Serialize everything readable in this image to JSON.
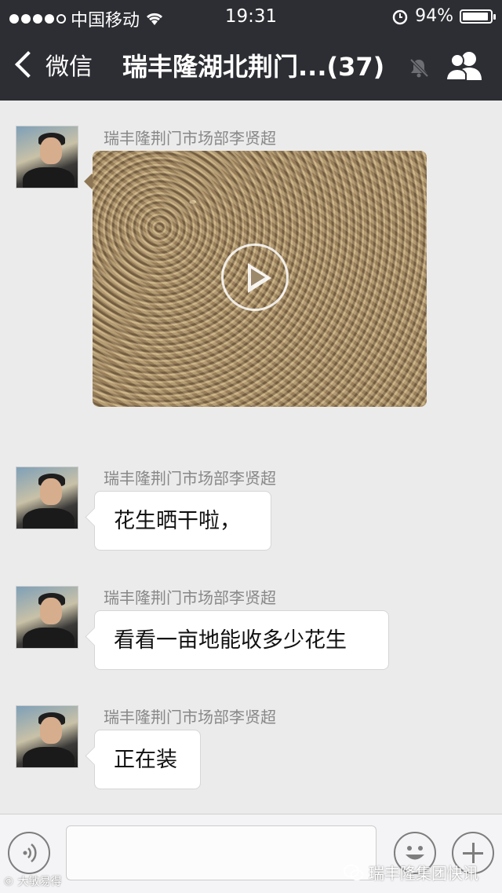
{
  "status_bar": {
    "carrier": "中国移动",
    "time": "19:31",
    "battery": "94%",
    "battery_level": 0.94
  },
  "nav": {
    "back_label": "微信",
    "title": "瑞丰隆湖北荆门...(37)"
  },
  "messages": [
    {
      "sender": "瑞丰隆荆门市场部李贤超",
      "type": "video"
    },
    {
      "sender": "瑞丰隆荆门市场部李贤超",
      "type": "text",
      "text": "花生晒干啦，"
    },
    {
      "sender": "瑞丰隆荆门市场部李贤超",
      "type": "text",
      "text": "看看一亩地能收多少花生"
    },
    {
      "sender": "瑞丰隆荆门市场部李贤超",
      "type": "text",
      "text": "正在装"
    }
  ],
  "watermark": {
    "left": "© 大敏易得",
    "right": "瑞丰隆集团快讯"
  },
  "icons": [
    "wifi-icon",
    "alarm-icon",
    "battery-icon",
    "back-chevron-icon",
    "mute-icon",
    "group-members-icon",
    "play-icon",
    "voice-icon",
    "emoji-icon",
    "plus-icon",
    "wechat-logo-icon"
  ]
}
